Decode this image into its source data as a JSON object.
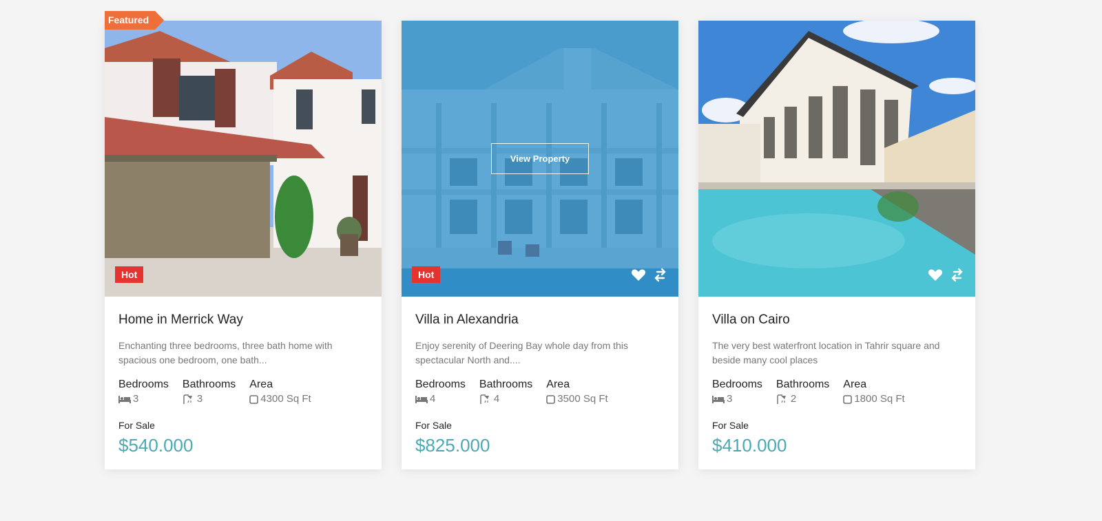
{
  "colors": {
    "price": "#4aa9b4",
    "hot_badge": "#e5342f",
    "featured_tag": "#ef6f3a",
    "hover_overlay": "#268cc8"
  },
  "cards": [
    {
      "featured_label": "Featured",
      "badge": "Hot",
      "title": "Home in Merrick Way",
      "description": "Enchanting three bedrooms, three bath home with spacious one bedroom, one bath...",
      "specs": {
        "bedrooms_label": "Bedrooms",
        "bedrooms": "3",
        "bathrooms_label": "Bathrooms",
        "bathrooms": "3",
        "area_label": "Area",
        "area": "4300 Sq Ft"
      },
      "status": "For Sale",
      "price": "$540.000"
    },
    {
      "badge": "Hot",
      "view_label": "View Property",
      "title": "Villa in Alexandria",
      "description": "Enjoy serenity of Deering Bay whole day from this spectacular North and....",
      "specs": {
        "bedrooms_label": "Bedrooms",
        "bedrooms": "4",
        "bathrooms_label": "Bathrooms",
        "bathrooms": "4",
        "area_label": "Area",
        "area": "3500 Sq Ft"
      },
      "status": "For Sale",
      "price": "$825.000"
    },
    {
      "title": "Villa on Cairo",
      "description": "The very best waterfront location in Tahrir square and beside many cool places",
      "specs": {
        "bedrooms_label": "Bedrooms",
        "bedrooms": "3",
        "bathrooms_label": "Bathrooms",
        "bathrooms": "2",
        "area_label": "Area",
        "area": "1800 Sq Ft"
      },
      "status": "For Sale",
      "price": "$410.000"
    }
  ]
}
